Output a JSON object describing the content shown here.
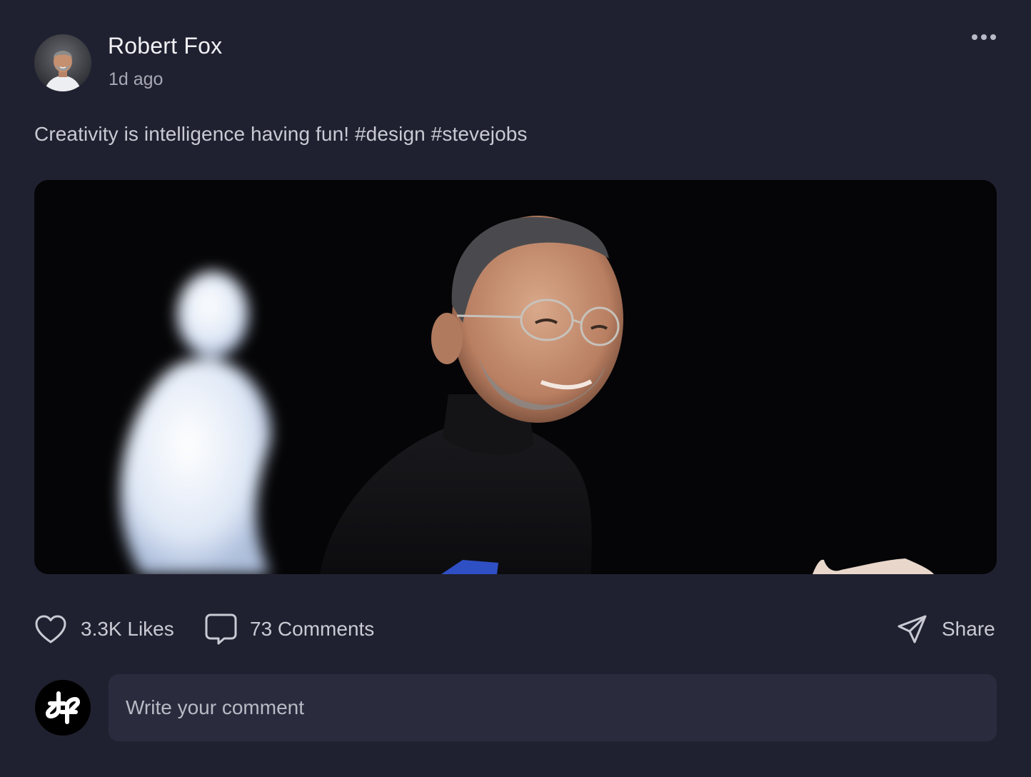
{
  "post": {
    "author": {
      "name": "Robert Fox",
      "time_ago": "1d ago",
      "avatar_icon": "user-avatar-photo"
    },
    "menu_icon": "more-horizontal-icon",
    "caption": "Creativity is intelligence having fun! #design #stevejobs",
    "image": {
      "description_icon": "post-photo"
    },
    "actions": {
      "likes_label": "3.3K Likes",
      "comments_label": "73 Comments",
      "share_label": "Share"
    },
    "composer": {
      "placeholder": "Write your comment",
      "value": "",
      "logo_icon": "brand-knot-logo-icon"
    }
  },
  "colors": {
    "background": "#202130",
    "input_background": "#2a2c3e",
    "text_primary": "#f1f1f5",
    "text_secondary": "#c9cad3",
    "text_muted": "#a7a8b3"
  }
}
